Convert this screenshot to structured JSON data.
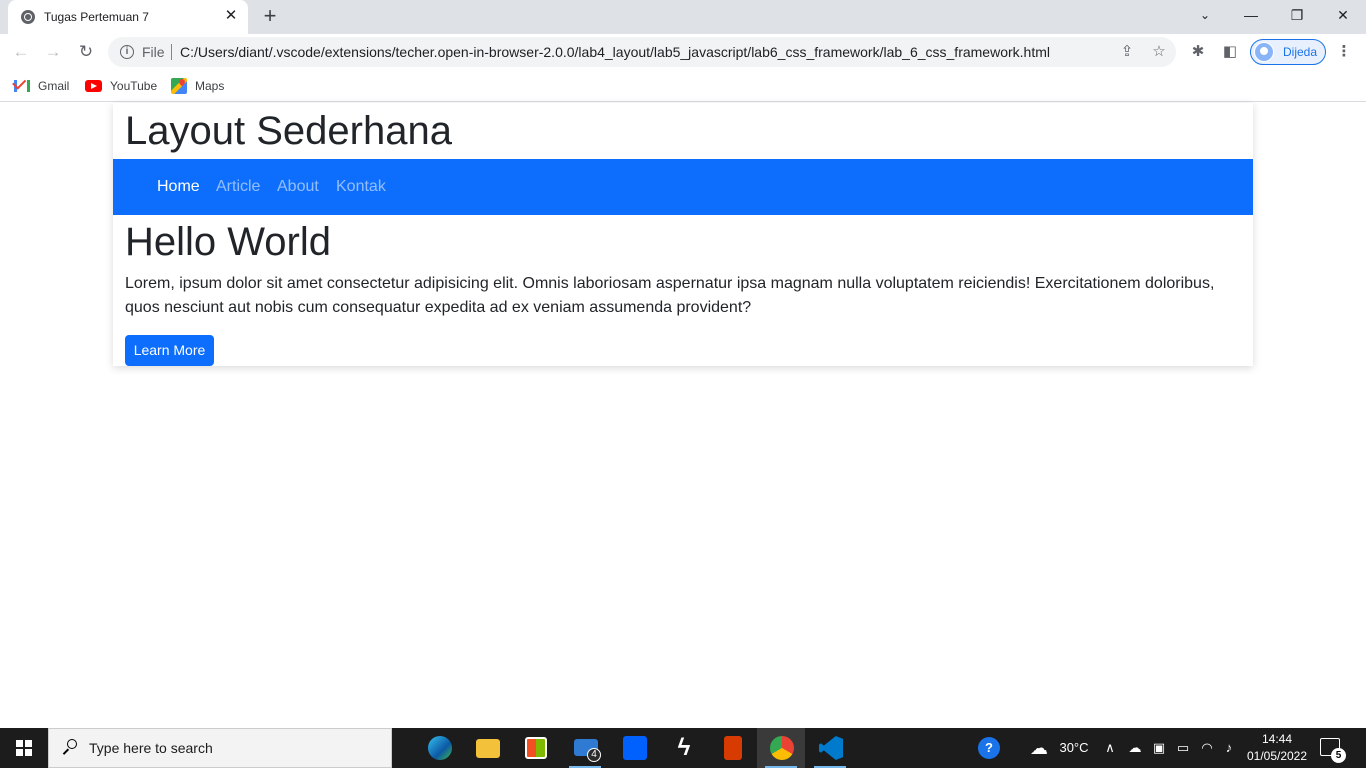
{
  "browser": {
    "tab_title": "Tugas Pertemuan 7",
    "file_label": "File",
    "url": "C:/Users/diant/.vscode/extensions/techer.open-in-browser-2.0.0/lab4_layout/lab5_javascript/lab6_css_framework/lab_6_css_framework.html",
    "profile_name": "Dijeda",
    "bookmarks": [
      {
        "label": "Gmail",
        "icon": "gmail-icon"
      },
      {
        "label": "YouTube",
        "icon": "youtube-icon"
      },
      {
        "label": "Maps",
        "icon": "maps-icon"
      }
    ]
  },
  "page": {
    "site_title": "Layout Sederhana",
    "nav": [
      {
        "label": "Home",
        "active": true
      },
      {
        "label": "Article",
        "active": false
      },
      {
        "label": "About",
        "active": false
      },
      {
        "label": "Kontak",
        "active": false
      }
    ],
    "hero_title": "Hello World",
    "hero_text": "Lorem, ipsum dolor sit amet consectetur adipisicing elit. Omnis laboriosam aspernatur ipsa magnam nulla voluptatem reiciendis! Exercitationem doloribus, quos nesciunt aut nobis cum consequatur expedita ad ex veniam assumenda provident?",
    "button_label": "Learn More"
  },
  "taskbar": {
    "search_placeholder": "Type here to search",
    "mail_badge": "4",
    "weather": "30°C",
    "time": "14:44",
    "date": "01/05/2022",
    "notification_count": "5"
  },
  "colors": {
    "primary": "#0d6efd",
    "taskbar": "#1c1c1c",
    "tabbar": "#dee1e6"
  }
}
